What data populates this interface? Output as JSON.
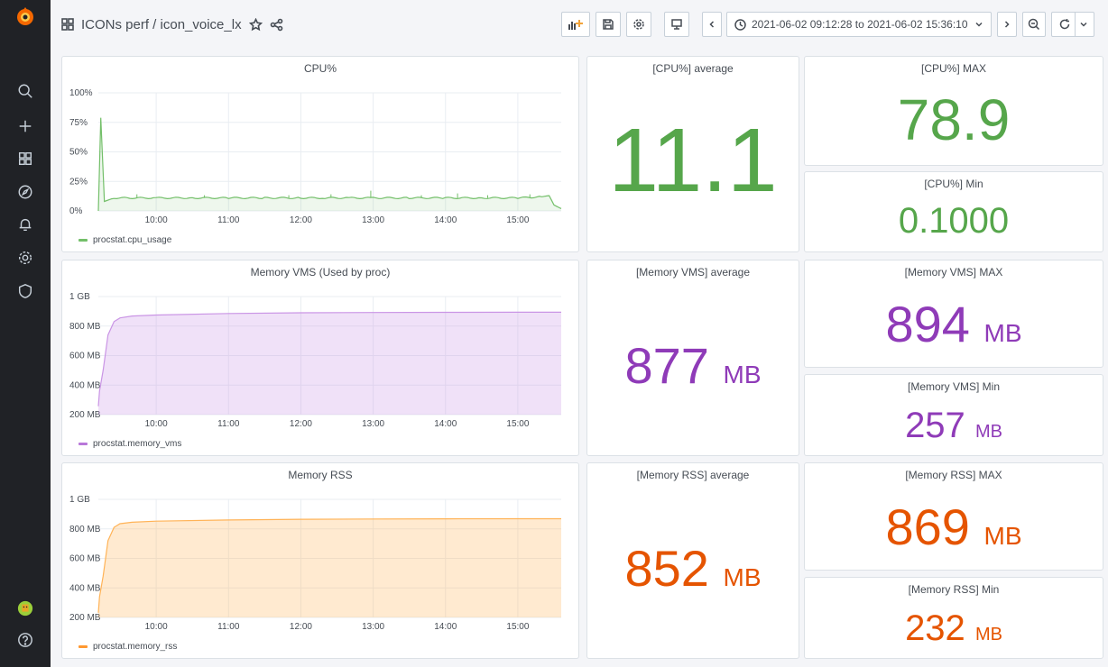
{
  "sidebar": {
    "icons": [
      "grafana-logo",
      "search-icon",
      "plus-icon",
      "dashboards-icon",
      "explore-icon",
      "alerting-icon",
      "configuration-icon",
      "shield-icon",
      "user-avatar",
      "help-icon"
    ]
  },
  "header": {
    "breadcrumb": "ICONs perf / icon_voice_lx",
    "time_range": "2021-06-02 09:12:28 to 2021-06-02 15:36:10"
  },
  "colors": {
    "green": "#56a64b",
    "purple": "#8f3bb8",
    "orange": "#e55400",
    "green_line": "#73bf69",
    "purple_line": "#ca95e5",
    "orange_line": "#ffb357"
  },
  "panels": {
    "cpu_avg": {
      "title": "[CPU%] average",
      "value": "11.1",
      "unit": ""
    },
    "cpu_max": {
      "title": "[CPU%] MAX",
      "value": "78.9",
      "unit": ""
    },
    "cpu_min": {
      "title": "[CPU%] Min",
      "value": "0.1000",
      "unit": ""
    },
    "vms_avg": {
      "title": "[Memory VMS] average",
      "value": "877",
      "unit": "MB"
    },
    "vms_max": {
      "title": "[Memory VMS] MAX",
      "value": "894",
      "unit": "MB"
    },
    "vms_min": {
      "title": "[Memory VMS] Min",
      "value": "257",
      "unit": "MB"
    },
    "rss_avg": {
      "title": "[Memory RSS] average",
      "value": "852",
      "unit": "MB"
    },
    "rss_max": {
      "title": "[Memory RSS] MAX",
      "value": "869",
      "unit": "MB"
    },
    "rss_min": {
      "title": "[Memory RSS] Min",
      "value": "232",
      "unit": "MB"
    }
  },
  "chart_data": [
    {
      "type": "line",
      "title": "CPU%",
      "x_ticks": [
        "10:00",
        "11:00",
        "12:00",
        "13:00",
        "14:00",
        "15:00"
      ],
      "y_ticks": [
        "0%",
        "25%",
        "50%",
        "75%",
        "100%"
      ],
      "ylim": [
        0,
        100
      ],
      "x_range": [
        "09:12",
        "15:36"
      ],
      "series": [
        {
          "name": "procstat.cpu_usage",
          "x": [
            "09:12",
            "09:14",
            "09:17",
            "09:25",
            "10:00",
            "10:30",
            "11:00",
            "11:30",
            "12:00",
            "12:20",
            "12:40",
            "13:00",
            "13:30",
            "14:00",
            "14:30",
            "15:00",
            "15:20",
            "15:26",
            "15:30",
            "15:36"
          ],
          "values": [
            0,
            78.9,
            8,
            11,
            11,
            11,
            11,
            11,
            11,
            11,
            11,
            11,
            11,
            11,
            11,
            11,
            12,
            13,
            5,
            2
          ]
        }
      ]
    },
    {
      "type": "area",
      "title": "Memory VMS (Used by proc)",
      "x_ticks": [
        "10:00",
        "11:00",
        "12:00",
        "13:00",
        "14:00",
        "15:00"
      ],
      "y_ticks": [
        "200 MB",
        "400 MB",
        "600 MB",
        "800 MB",
        "1 GB"
      ],
      "ylim_mb": [
        200,
        1000
      ],
      "x_range": [
        "09:12",
        "15:36"
      ],
      "series": [
        {
          "name": "procstat.memory_vms",
          "x": [
            "09:12",
            "09:13",
            "09:16",
            "09:20",
            "09:25",
            "09:30",
            "09:40",
            "10:00",
            "11:00",
            "12:00",
            "13:00",
            "14:00",
            "15:00",
            "15:36"
          ],
          "values": [
            257,
            360,
            500,
            740,
            830,
            855,
            868,
            875,
            885,
            890,
            892,
            893,
            894,
            894
          ]
        }
      ]
    },
    {
      "type": "area",
      "title": "Memory RSS",
      "x_ticks": [
        "10:00",
        "11:00",
        "12:00",
        "13:00",
        "14:00",
        "15:00"
      ],
      "y_ticks": [
        "200 MB",
        "400 MB",
        "600 MB",
        "800 MB",
        "1 GB"
      ],
      "ylim_mb": [
        200,
        1000
      ],
      "x_range": [
        "09:12",
        "15:36"
      ],
      "series": [
        {
          "name": "procstat.memory_rss",
          "x": [
            "09:12",
            "09:13",
            "09:16",
            "09:20",
            "09:25",
            "09:30",
            "09:40",
            "10:00",
            "11:00",
            "12:00",
            "13:00",
            "14:00",
            "15:00",
            "15:36"
          ],
          "values": [
            232,
            340,
            480,
            720,
            810,
            835,
            845,
            852,
            860,
            865,
            867,
            868,
            869,
            869
          ]
        }
      ]
    }
  ]
}
